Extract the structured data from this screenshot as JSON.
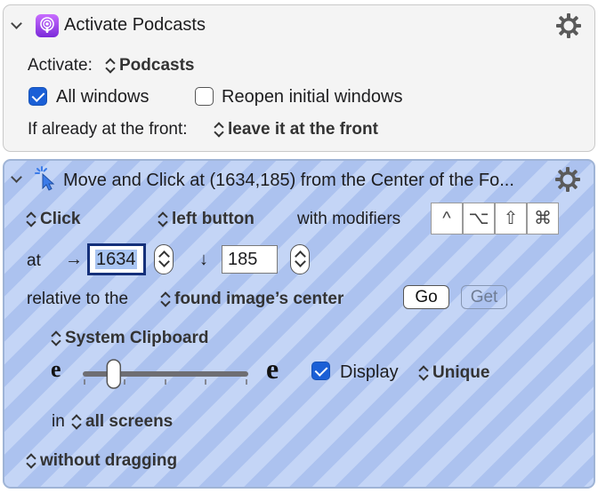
{
  "action1": {
    "title": "Activate Podcasts",
    "activate_label": "Activate:",
    "activate_app": "Podcasts",
    "all_windows_label": "All windows",
    "all_windows_checked": true,
    "reopen_label": "Reopen initial windows",
    "reopen_checked": false,
    "front_label": "If already at the front:",
    "front_value": "leave it at the front"
  },
  "action2": {
    "title": "Move and Click at (1634,185) from the Center of the Fo...",
    "click_value": "Click",
    "button_value": "left button",
    "modifiers_label": "with modifiers",
    "modifiers": [
      "^",
      "⌥",
      "⇧",
      "⌘"
    ],
    "at_label": "at",
    "x_arrow": "→",
    "x_value": "1634",
    "y_arrow": "↓",
    "y_value": "185",
    "relative_label": "relative to the",
    "relative_value": "found image’s center",
    "go_label": "Go",
    "get_label": "Get",
    "source_value": "System Clipboard",
    "fuzz_small": "e",
    "fuzz_large": "e",
    "fuzz_level": 0.18,
    "display_label": "Display",
    "display_checked": true,
    "unique_value": "Unique",
    "in_label": "in",
    "screens_value": "all screens",
    "drag_value": "without dragging"
  },
  "colors": {
    "selected_background": "#c4d5f6",
    "checkbox_blue": "#1a5fd6"
  }
}
